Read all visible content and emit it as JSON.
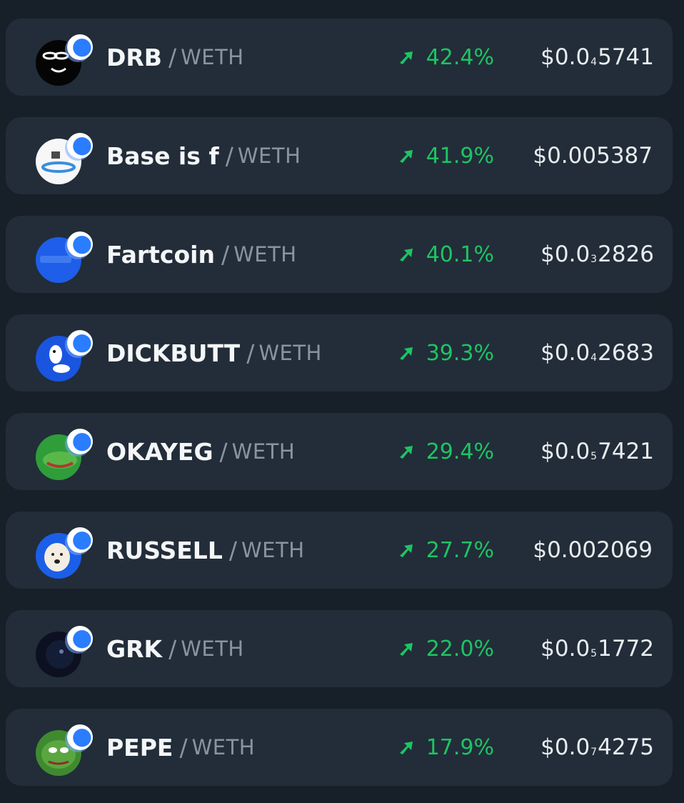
{
  "tokens": [
    {
      "symbol": "DRB",
      "quote": "WETH",
      "change": "42.4%",
      "price": {
        "prefix": "$0.0",
        "zeros": "4",
        "digits": "5741"
      },
      "avatar_icon": "drb-face-icon",
      "chain_icon": "base-chain-icon"
    },
    {
      "symbol": "Base is f",
      "quote": "WETH",
      "change": "41.9%",
      "price": {
        "prefix": "$0.005387",
        "zeros": "",
        "digits": ""
      },
      "avatar_icon": "base-is-f-icon",
      "chain_icon": "base-chain-icon"
    },
    {
      "symbol": "Fartcoin",
      "quote": "WETH",
      "change": "40.1%",
      "price": {
        "prefix": "$0.0",
        "zeros": "3",
        "digits": "2826"
      },
      "avatar_icon": "fartcoin-icon",
      "chain_icon": "base-chain-icon"
    },
    {
      "symbol": "DICKBUTT",
      "quote": "WETH",
      "change": "39.3%",
      "price": {
        "prefix": "$0.0",
        "zeros": "4",
        "digits": "2683"
      },
      "avatar_icon": "dickbutt-icon",
      "chain_icon": "base-chain-icon"
    },
    {
      "symbol": "OKAYEG",
      "quote": "WETH",
      "change": "29.4%",
      "price": {
        "prefix": "$0.0",
        "zeros": "5",
        "digits": "7421"
      },
      "avatar_icon": "okayeg-frog-icon",
      "chain_icon": "base-chain-icon"
    },
    {
      "symbol": "RUSSELL",
      "quote": "WETH",
      "change": "27.7%",
      "price": {
        "prefix": "$0.002069",
        "zeros": "",
        "digits": ""
      },
      "avatar_icon": "russell-dog-icon",
      "chain_icon": "base-chain-icon"
    },
    {
      "symbol": "GRK",
      "quote": "WETH",
      "change": "22.0%",
      "price": {
        "prefix": "$0.0",
        "zeros": "5",
        "digits": "1772"
      },
      "avatar_icon": "grk-icon",
      "chain_icon": "base-chain-icon"
    },
    {
      "symbol": "PEPE",
      "quote": "WETH",
      "change": "17.9%",
      "price": {
        "prefix": "$0.0",
        "zeros": "7",
        "digits": "4275"
      },
      "avatar_icon": "pepe-frog-icon",
      "chain_icon": "base-chain-icon"
    }
  ],
  "colors": {
    "background": "#172029",
    "row": "#222d39",
    "positive": "#1ec463",
    "symbol": "#f4f6f8",
    "quote": "#8a94a1",
    "chain_badge": "#2a7dff"
  }
}
